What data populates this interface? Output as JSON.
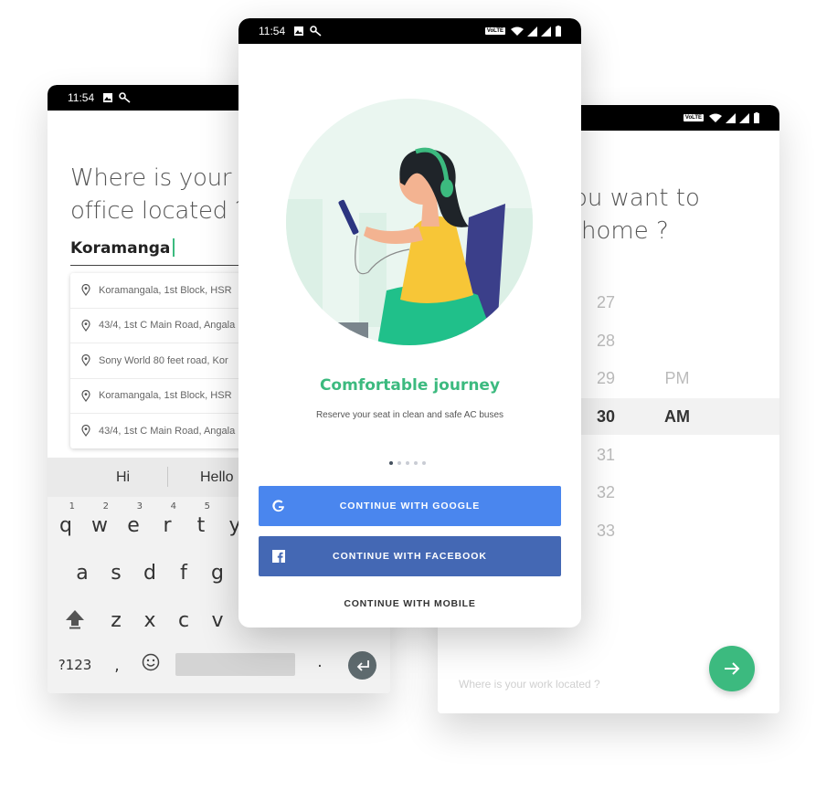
{
  "left_screen": {
    "status_time": "11:54",
    "question": "Where is your office located ?",
    "question_line1": "Where is your",
    "question_line2": "office located ?",
    "input_value": "Koramanga",
    "suggestions": [
      "Koramangala, 1st Block, HSR",
      "43/4, 1st C Main Road, Angala",
      "Sony World 80 feet road, Kor",
      "Koramangala, 1st Block, HSR",
      "43/4, 1st C Main Road, Angala"
    ],
    "keyboard": {
      "suggestions": [
        "Hi",
        "Hello"
      ],
      "row1": [
        "q",
        "w",
        "e",
        "r",
        "t",
        "y"
      ],
      "row1_hints": [
        "1",
        "2",
        "3",
        "4",
        "5"
      ],
      "row2": [
        "a",
        "s",
        "d",
        "f",
        "g"
      ],
      "row3": [
        "z",
        "x",
        "c",
        "v"
      ],
      "symbols_label": "?123",
      "comma": ",",
      "period": "."
    }
  },
  "center_screen": {
    "status_time": "11:54",
    "volte_badge": "VoLTE",
    "title": "Comfortable journey",
    "subtitle": "Reserve your seat in clean and safe AC buses",
    "page_dots": 5,
    "active_dot": 0,
    "google_button": "CONTINUE WITH GOOGLE",
    "facebook_button": "CONTINUE WITH FACEBOOK",
    "mobile_link": "CONTINUE WITH MOBILE",
    "colors": {
      "accent_green": "#3cba7f",
      "google_blue": "#4a86ee",
      "facebook_blue": "#4468b4"
    }
  },
  "right_screen": {
    "volte_badge": "VoLTE",
    "question_line1": "ou want to",
    "question_line2": "home ?",
    "picker_numbers": [
      "27",
      "28",
      "29",
      "30",
      "31",
      "32",
      "33"
    ],
    "selected_number": "30",
    "meridiem_options": [
      "PM",
      "AM"
    ],
    "selected_meridiem": "AM",
    "work_placeholder": "Where is your work located ?"
  }
}
